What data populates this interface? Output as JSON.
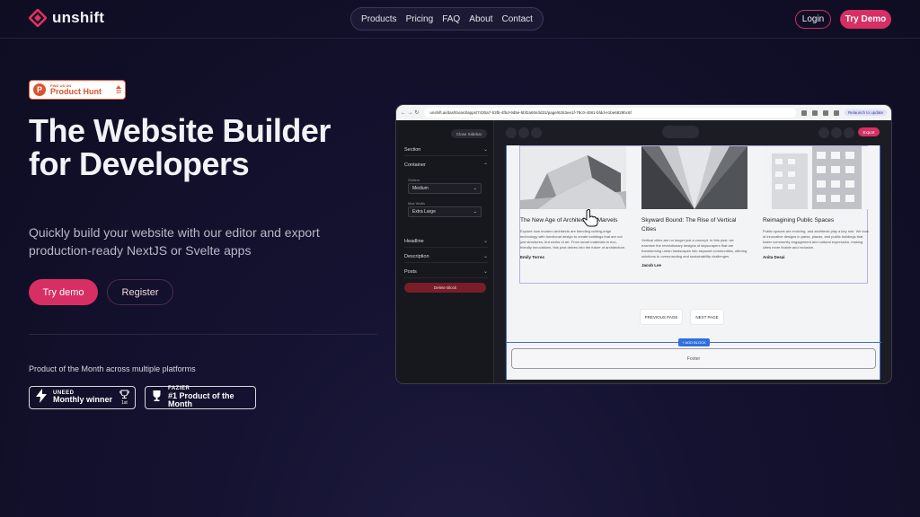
{
  "brand": {
    "name": "unshift"
  },
  "nav": {
    "items": [
      "Products",
      "Pricing",
      "FAQ",
      "About",
      "Contact"
    ]
  },
  "header": {
    "login": "Login",
    "try_demo": "Try Demo"
  },
  "product_hunt": {
    "small": "FIND US ON",
    "name": "Product Hunt",
    "votes": "33"
  },
  "hero": {
    "title": "The Website Builder for Developers",
    "subtitle": "Quickly build your website with our editor and export production-ready NextJS or Svelte apps",
    "btn_demo": "Try demo",
    "btn_register": "Register"
  },
  "awards": {
    "caption": "Product of the Month across multiple platforms",
    "uneed": {
      "brand": "UNEED",
      "title": "Monthly winner",
      "rank": "1st"
    },
    "fazier": {
      "brand": "FAZIER",
      "title": "#1 Product of the Month"
    }
  },
  "browser": {
    "url": "unshift.ai/dashboard/apps/7430a7-b3fb-4fbd-9d5e-5bf2a60e3d31/page/6263ee1f-78c0-4081-bfdd-e1be6829bc6f",
    "relaunch": "Relaunch to update"
  },
  "editor": {
    "close_sidebar": "Close Sidebar",
    "sections": {
      "section": "Section",
      "container": "Container",
      "headline": "Headline",
      "description": "Description",
      "posts": "Posts"
    },
    "gutters_label": "Gutters",
    "gutters_value": "Medium",
    "max_width_label": "Max Width",
    "max_width_value": "Extra Large",
    "delete_block": "Delete Block",
    "export": "Export",
    "prev_page": "PREVIOUS PAGE",
    "next_page": "NEXT PAGE",
    "add_block": "+ ADD BLOCK",
    "footer": "Footer"
  },
  "posts": [
    {
      "title": "The New Age of Architectural Marvels",
      "body": "Explore how modern architects are blending cutting-edge technology with functional design to create buildings that are not just structures, but works of art. From smart materials to eco-friendly innovations, this post delves into the future of architecture.",
      "author": "Emily Torres"
    },
    {
      "title": "Skyward Bound: The Rise of Vertical Cities",
      "body": "Vertical cities are no longer just a concept. In this post, we examine the revolutionary designs of skyscrapers that are transforming urban landscapes into skyward communities, offering solutions to overcrowding and sustainability challenges.",
      "author": "Jacob Lee"
    },
    {
      "title": "Reimagining Public Spaces",
      "body": "Public spaces are evolving, and architects play a key role. We look at innovative designs in parks, plazas, and public buildings that foster community engagement and cultural expression, making cities more livable and inclusive.",
      "author": "Anita Desai"
    }
  ],
  "colors": {
    "accent": "#d72f63",
    "background": "#141230",
    "selection": "#4169e1"
  }
}
